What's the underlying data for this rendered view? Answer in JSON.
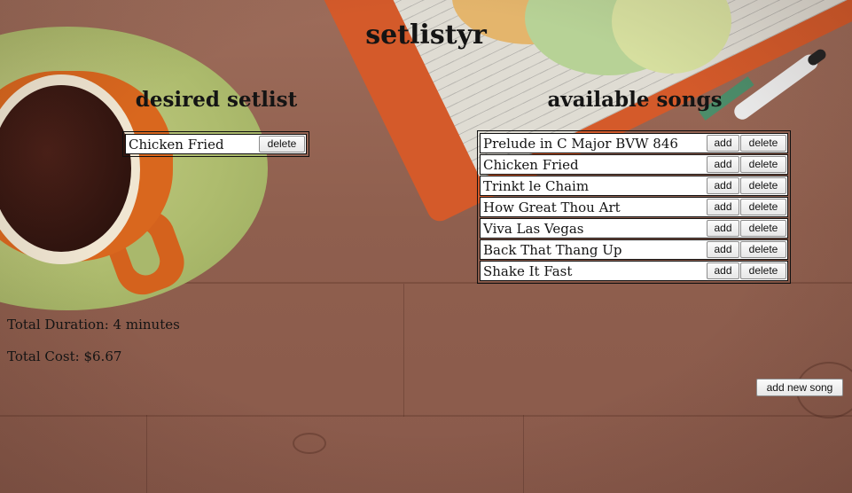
{
  "app": {
    "title": "setlistyr"
  },
  "desired_setlist": {
    "heading": "desired setlist",
    "songs": [
      {
        "name": "Chicken Fried",
        "delete_label": "delete"
      }
    ]
  },
  "available_songs": {
    "heading": "available songs",
    "add_label": "add",
    "delete_label": "delete",
    "songs": [
      {
        "name": "Prelude in C Major BVW 846"
      },
      {
        "name": "Chicken Fried"
      },
      {
        "name": "Trinkt le Chaim"
      },
      {
        "name": "How Great Thou Art"
      },
      {
        "name": "Viva Las Vegas"
      },
      {
        "name": "Back That Thang Up"
      },
      {
        "name": "Shake It Fast"
      }
    ]
  },
  "totals": {
    "duration": "Total Duration: 4 minutes",
    "cost": "Total Cost: $6.67"
  },
  "actions": {
    "add_new_song_label": "add new song"
  },
  "colors": {
    "button_border": "#8c8c8c",
    "row_background": "#ffffff",
    "text": "#141414"
  }
}
